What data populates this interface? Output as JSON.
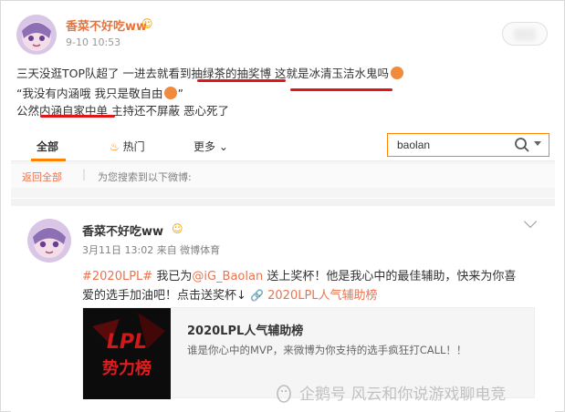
{
  "top_post": {
    "user_name": "香菜不好吃ww",
    "badge": "☺",
    "timestamp": "9-10 10:53",
    "lines": [
      "三天没逛TOP队超了 一进去就看到抽绿茶的抽奖博 这就是冰清玉洁水鬼吗",
      "“我没有内涵哦 我只是敬自由",
      "”",
      "公然内涵自家中单 主持还不屏蔽 恶心死了"
    ]
  },
  "tabs": {
    "all": "全部",
    "hot": "热门",
    "more": "更多"
  },
  "search": {
    "value": "baolan"
  },
  "breadcrumb": {
    "back": "返回全部",
    "separator": "|",
    "text": "为您搜索到以下微博:"
  },
  "card_post": {
    "user_name": "香菜不好吃ww",
    "badge": "☺",
    "meta": "3月11日 13:02 来自 微博体育",
    "hashtag": "#2020LPL#",
    "text_1": " 我已为",
    "mention": "@iG_Baolan",
    "text_2": " 送上奖杯！他是我心中的最佳辅助，快来为你喜",
    "line2_text": "爱的选手加油吧！点击送奖杯↓ ",
    "topic_link": "2020LPL人气辅助榜",
    "topic_card": {
      "logo_text_1": "LPL",
      "logo_text_2": "势力榜",
      "title": "2020LPL人气辅助榜",
      "desc": "谁是你心中的MVP，来微博为你支持的选手疯狂打CALL！！"
    }
  },
  "watermark": "企鹅号 风云和你说游戏聊电竞",
  "colors": {
    "accent_orange": "#ff8200",
    "link": "#eb7350",
    "underline_red": "#e0161b",
    "name_orange": "#e8733a"
  }
}
